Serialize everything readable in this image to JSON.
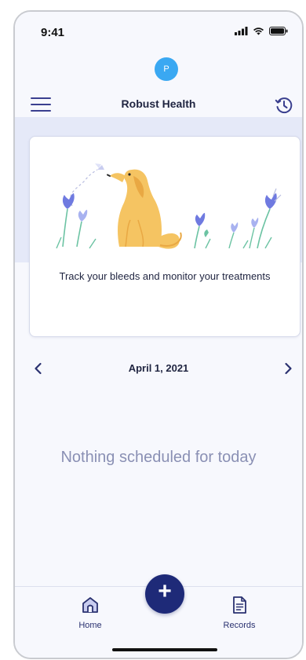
{
  "status_bar": {
    "time": "9:41"
  },
  "header": {
    "avatar_initial": "P",
    "title": "Robust Health",
    "menu_icon": "hamburger-menu-icon",
    "history_icon": "clock-history-icon"
  },
  "hero_card": {
    "caption": "Track your bleeds and monitor your treatments",
    "illustration": "dog-with-flowers-illustration"
  },
  "date_nav": {
    "date": "April 1, 2021",
    "prev_icon": "chevron-left-icon",
    "next_icon": "chevron-right-icon"
  },
  "empty_state": {
    "message": "Nothing scheduled for today"
  },
  "tab_bar": {
    "home_label": "Home",
    "records_label": "Records",
    "add_symbol": "+"
  },
  "colors": {
    "accent": "#1e2a78",
    "avatar": "#3aa8f2",
    "empty_text": "#8a90b4",
    "band": "#e5e9f8"
  }
}
